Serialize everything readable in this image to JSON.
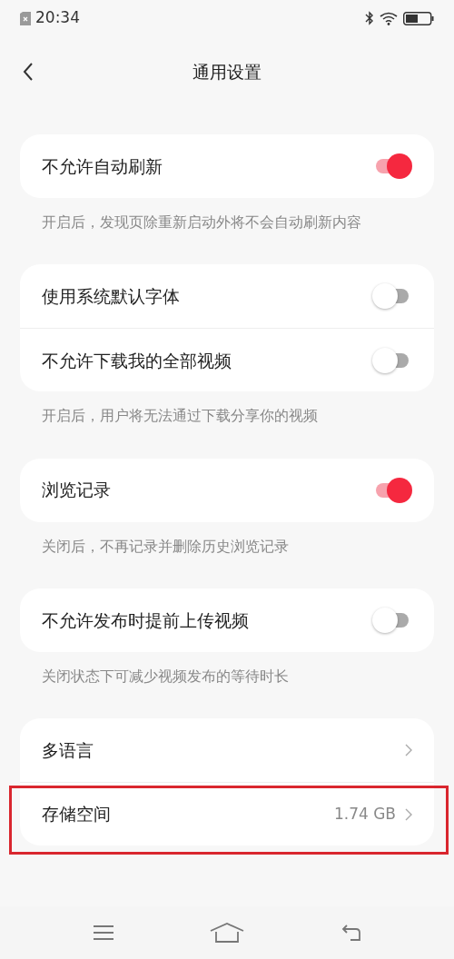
{
  "status_bar": {
    "time": "20:34"
  },
  "header": {
    "title": "通用设置"
  },
  "groups": [
    {
      "rows": [
        {
          "kind": "toggle",
          "label": "不允许自动刷新",
          "on": true
        }
      ],
      "note": "开启后，发现页除重新启动外将不会自动刷新内容"
    },
    {
      "rows": [
        {
          "kind": "toggle",
          "label": "使用系统默认字体",
          "on": false
        },
        {
          "kind": "toggle",
          "label": "不允许下载我的全部视频",
          "on": false
        }
      ],
      "note": "开启后，用户将无法通过下载分享你的视频"
    },
    {
      "rows": [
        {
          "kind": "toggle",
          "label": "浏览记录",
          "on": true
        }
      ],
      "note": "关闭后，不再记录并删除历史浏览记录"
    },
    {
      "rows": [
        {
          "kind": "toggle",
          "label": "不允许发布时提前上传视频",
          "on": false
        }
      ],
      "note": "关闭状态下可减少视频发布的等待时长"
    },
    {
      "rows": [
        {
          "kind": "link",
          "label": "多语言",
          "highlighted": false
        },
        {
          "kind": "link",
          "label": "存储空间",
          "value": "1.74 GB",
          "highlighted": true
        }
      ]
    }
  ]
}
